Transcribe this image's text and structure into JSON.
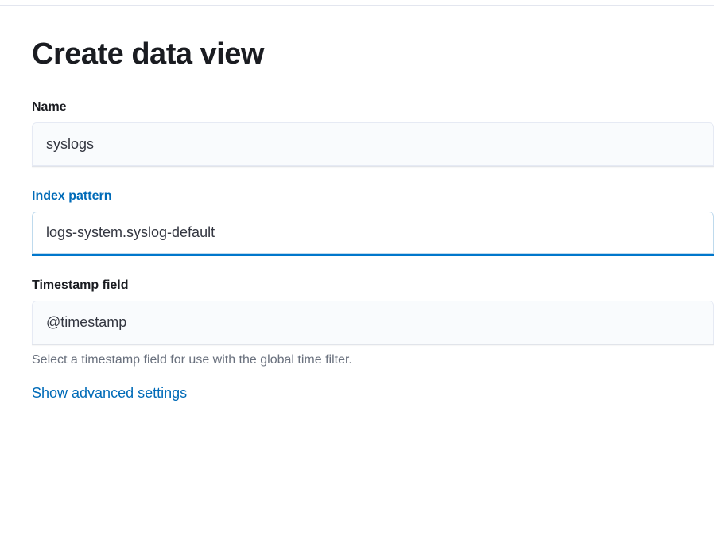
{
  "page": {
    "title": "Create data view"
  },
  "form": {
    "name": {
      "label": "Name",
      "value": "syslogs"
    },
    "index_pattern": {
      "label": "Index pattern",
      "value": "logs-system.syslog-default"
    },
    "timestamp": {
      "label": "Timestamp field",
      "value": "@timestamp",
      "help": "Select a timestamp field for use with the global time filter."
    },
    "advanced_link": "Show advanced settings"
  }
}
